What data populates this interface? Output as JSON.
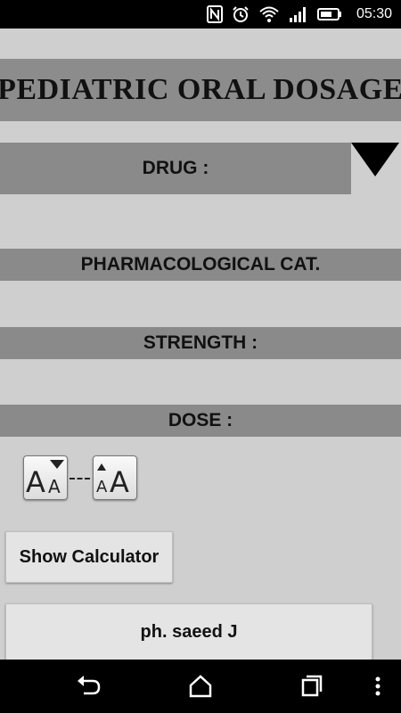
{
  "status_bar": {
    "time": "05:30",
    "icons": [
      "nfc-icon",
      "alarm-icon",
      "wifi-icon",
      "signal-icon",
      "battery-icon"
    ]
  },
  "header": {
    "title": "PEDIATRIC ORAL DOSAGE"
  },
  "fields": {
    "drug_label": "DRUG :",
    "pharm_label": "PHARMACOLOGICAL CAT.",
    "strength_label": "STRENGTH :",
    "dose_label": "DOSE :"
  },
  "font_controls": {
    "decrease_icon": "font-size-decrease-icon",
    "increase_icon": "font-size-increase-icon"
  },
  "buttons": {
    "show_calculator": "Show Calculator",
    "credit": "ph. saeed J"
  },
  "nav_bar": {
    "icons": [
      "back-icon",
      "home-icon",
      "recent-apps-icon",
      "overflow-menu-icon"
    ]
  },
  "colors": {
    "background": "#cfcfcf",
    "band": "#8a8a8a",
    "title_band": "#8c8c8c",
    "system_bars": "#000000"
  }
}
